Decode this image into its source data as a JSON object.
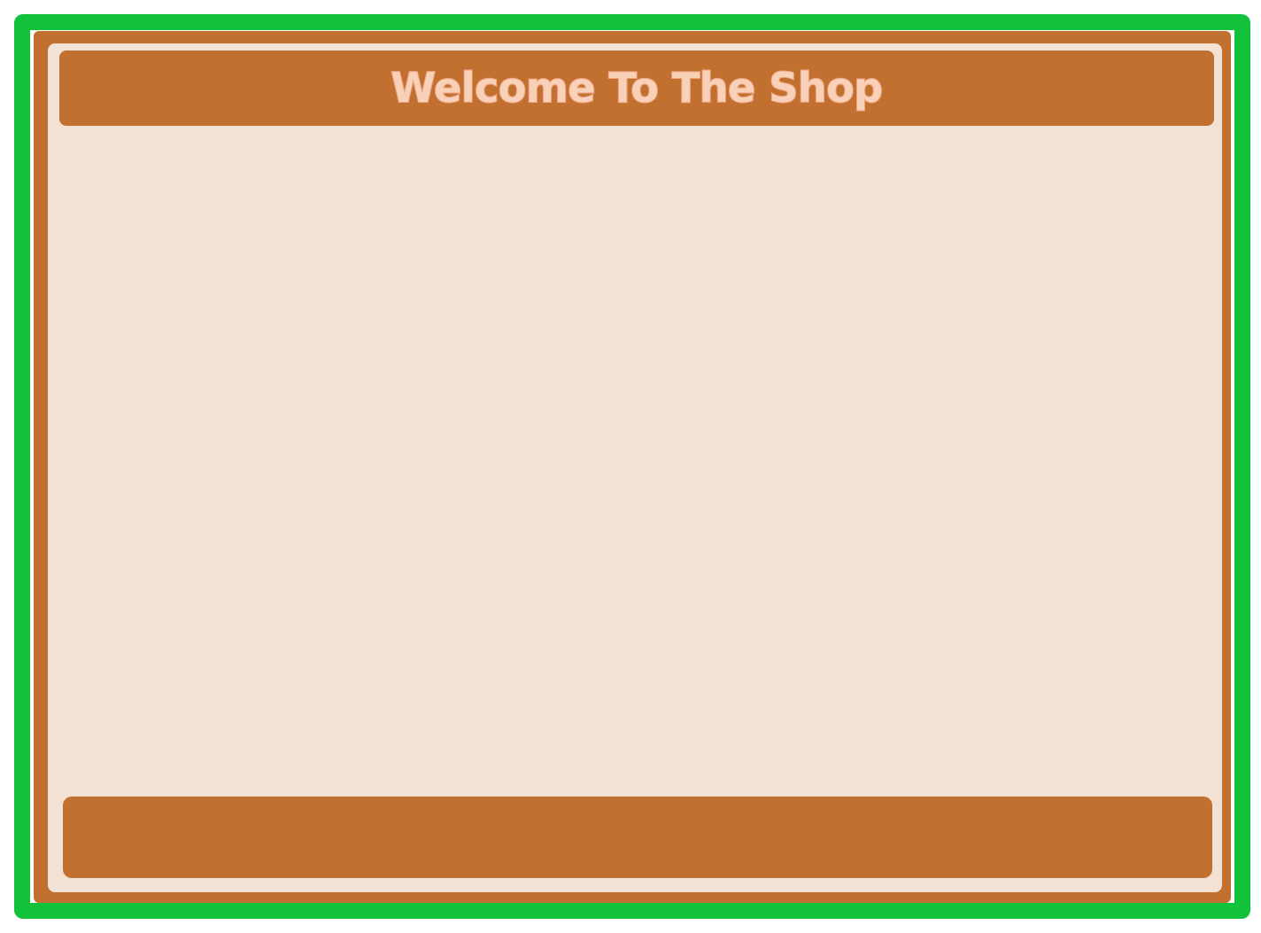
{
  "shop": {
    "title": "Welcome To The Shop"
  },
  "colors": {
    "outer_border": "#12c23a",
    "wood": "#c2702f",
    "panel": "#f3e1d3",
    "title_text": "#f9d0b8"
  }
}
